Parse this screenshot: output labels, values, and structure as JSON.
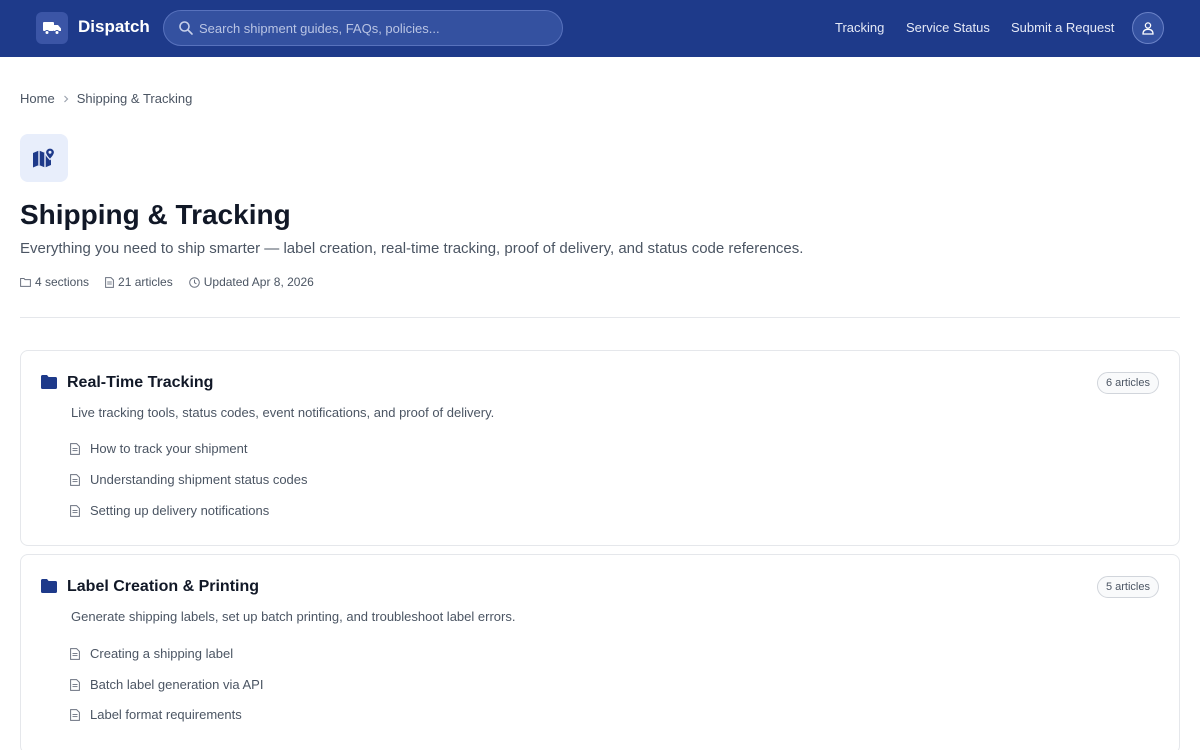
{
  "app": {
    "name": "Dispatch"
  },
  "search": {
    "placeholder": "Search shipment guides, FAQs, policies..."
  },
  "nav": {
    "links": [
      "Tracking",
      "Service Status",
      "Submit a Request"
    ]
  },
  "breadcrumb": [
    "Home",
    "Shipping & Tracking"
  ],
  "category": {
    "title": "Shipping & Tracking",
    "description": "Everything you need to ship smarter — label creation, real-time tracking, proof of delivery, and status code references.",
    "meta": {
      "sections": "4 sections",
      "articles": "21 articles",
      "updated": "Updated Apr 8, 2026"
    }
  },
  "sections": [
    {
      "title": "Real-Time Tracking",
      "count": "6 articles",
      "description": "Live tracking tools, status codes, event notifications, and proof of delivery.",
      "articles": [
        "How to track your shipment",
        "Understanding shipment status codes",
        "Setting up delivery notifications"
      ]
    },
    {
      "title": "Label Creation & Printing",
      "count": "5 articles",
      "description": "Generate shipping labels, set up batch printing, and troubleshoot label errors.",
      "articles": [
        "Creating a shipping label",
        "Batch label generation via API",
        "Label format requirements"
      ]
    }
  ],
  "colors": {
    "brand": "#1e3a8a",
    "accent": "#1e3a8a"
  },
  "icons": {
    "logo": "truck-icon",
    "search": "search-icon",
    "avatar": "user-icon",
    "category": "map-icon",
    "section": "folder-icon",
    "article": "document-icon"
  }
}
